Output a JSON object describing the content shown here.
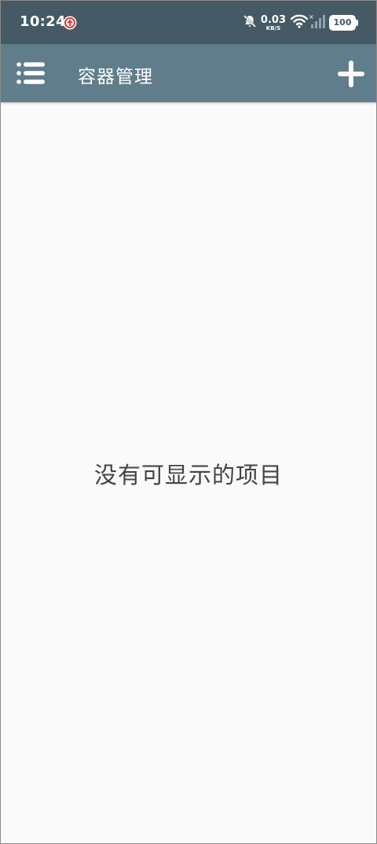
{
  "status_bar": {
    "time": "10:24",
    "net_speed_value": "0.03",
    "net_speed_unit": "KB/S",
    "battery": "100",
    "icons": [
      "notification-badge-icon",
      "bell-muted-icon",
      "wifi-icon",
      "cellular-signal-icon",
      "battery-icon"
    ]
  },
  "app_bar": {
    "title": "容器管理",
    "menu_icon": "list-menu-icon",
    "add_icon": "plus-icon"
  },
  "main": {
    "empty_message": "没有可显示的项目"
  },
  "colors": {
    "status_bar_bg": "#455a64",
    "app_bar_bg": "#607d8b",
    "content_bg": "#fafafa",
    "empty_text": "#444444"
  }
}
